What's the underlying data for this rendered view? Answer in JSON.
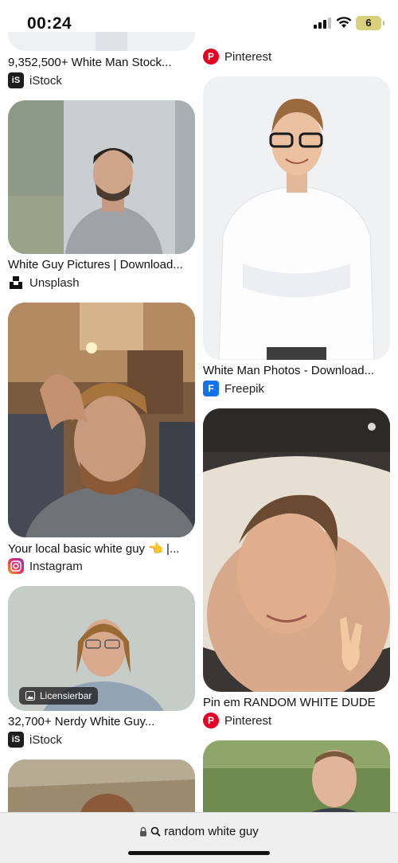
{
  "status": {
    "time": "00:24",
    "battery": "6"
  },
  "results": [
    {
      "title": "9,352,500+ White Man Stock...",
      "source": "iStock",
      "icon": "istock-icon"
    },
    {
      "title": "",
      "source": "Pinterest",
      "icon": "pinterest-icon"
    },
    {
      "title": "White Guy Pictures | Download...",
      "source": "Unsplash",
      "icon": "unsplash-icon"
    },
    {
      "title": "White Man Photos - Download...",
      "source": "Freepik",
      "icon": "freepik-icon"
    },
    {
      "title": "Your local basic white guy 👈 |...",
      "source": "Instagram",
      "icon": "instagram-icon"
    },
    {
      "title": "Pin em RANDOM WHITE DUDE",
      "source": "Pinterest",
      "icon": "pinterest-icon"
    },
    {
      "title": "32,700+ Nerdy White Guy...",
      "source": "iStock",
      "icon": "istock-icon",
      "badge": "Licensierbar"
    }
  ],
  "address_bar": {
    "query": "random white guy"
  }
}
